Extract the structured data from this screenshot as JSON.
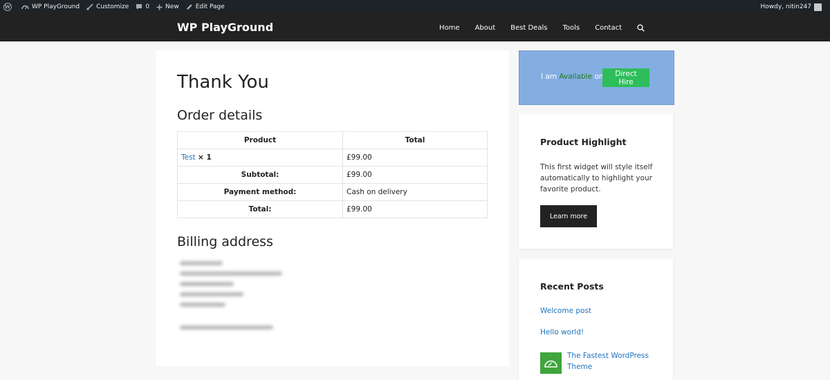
{
  "adminbar": {
    "site_name": "WP PlayGround",
    "customize": "Customize",
    "comments_count": "0",
    "new": "New",
    "edit_page": "Edit Page",
    "howdy": "Howdy, nitin247"
  },
  "header": {
    "site_title": "WP PlayGround",
    "nav": [
      "Home",
      "About",
      "Best Deals",
      "Tools",
      "Contact"
    ]
  },
  "main": {
    "page_title": "Thank You",
    "order_heading": "Order details",
    "table": {
      "headers": [
        "Product",
        "Total"
      ],
      "item": {
        "product_link": "Test",
        "qty": "× 1",
        "total": "£99.00"
      },
      "rows": [
        {
          "label": "Subtotal:",
          "value": "£99.00"
        },
        {
          "label": "Payment method:",
          "value": "Cash on delivery"
        },
        {
          "label": "Total:",
          "value": "£99.00"
        }
      ]
    },
    "billing_heading": "Billing address"
  },
  "sidebar": {
    "hire": {
      "prefix": "I am",
      "available": "Available",
      "on": "on",
      "button": "Direct Hire"
    },
    "highlight": {
      "title": "Product Highlight",
      "text": "This first widget will style itself automatically to highlight your favorite product.",
      "button": "Learn more"
    },
    "recent": {
      "title": "Recent Posts",
      "posts": [
        "Welcome post",
        "Hello world!",
        "The Fastest WordPress Theme"
      ]
    }
  },
  "colors": {
    "adminbar_bg": "#1d2327",
    "header_bg": "#222222",
    "link": "#1e73be",
    "hire_box": "#84aee2",
    "hire_button": "#2dbd5a"
  }
}
